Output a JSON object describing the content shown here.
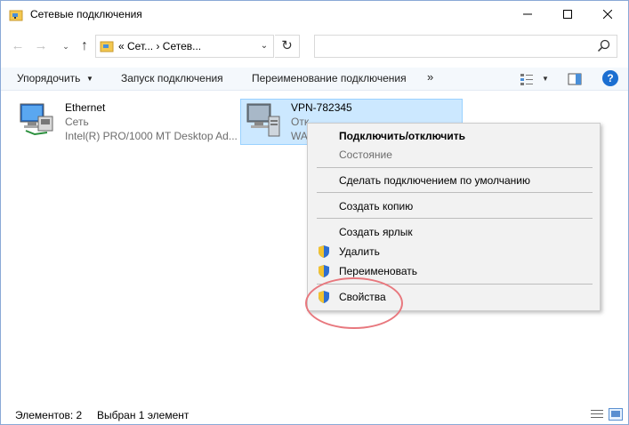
{
  "window": {
    "title": "Сетевые подключения",
    "min_icon": "minimize-icon",
    "max_icon": "maximize-icon",
    "close_icon": "close-icon"
  },
  "nav": {
    "back_icon": "back-arrow-icon",
    "forward_icon": "forward-arrow-icon",
    "recent_icon": "chevron-down-icon",
    "up_icon": "up-arrow-icon",
    "address_text": "« Сет... › Сетев...",
    "refresh_icon": "refresh-icon",
    "search_placeholder": ""
  },
  "commandbar": {
    "organize": "Упорядочить",
    "start_connection": "Запуск подключения",
    "rename_connection": "Переименование подключения",
    "more": "»",
    "help": "?"
  },
  "items": [
    {
      "name": "Ethernet",
      "line2": "Сеть",
      "line3": "Intel(R) PRO/1000 MT Desktop Ad...",
      "icon": "network-adapter-icon"
    },
    {
      "name": "VPN-782345",
      "line2": "Отк",
      "line3": "WA",
      "icon": "vpn-adapter-icon",
      "selected": true
    }
  ],
  "context_menu": {
    "connect": "Подключить/отключить",
    "status": "Состояние",
    "set_default": "Сделать подключением по умолчанию",
    "create_copy": "Создать копию",
    "create_shortcut": "Создать ярлык",
    "delete": "Удалить",
    "rename": "Переименовать",
    "properties": "Свойства"
  },
  "statusbar": {
    "count": "Элементов: 2",
    "selected": "Выбран 1 элемент"
  },
  "colors": {
    "selection_bg": "#cce8ff",
    "selection_border": "#99d1ff",
    "highlight_ring": "#e8787e",
    "help_blue": "#1c6fd1"
  }
}
